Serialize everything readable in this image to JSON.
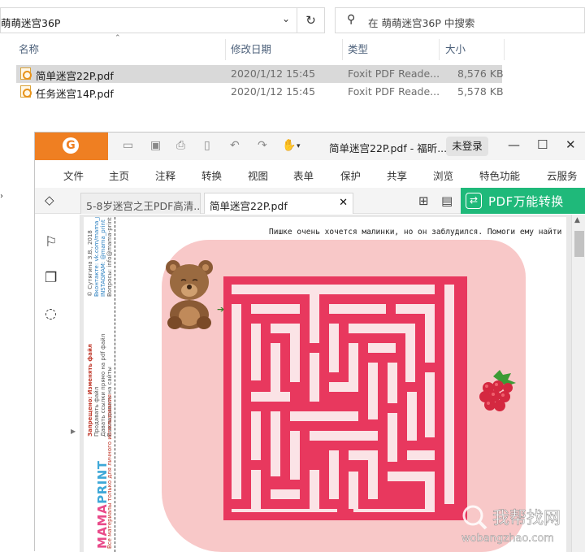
{
  "explorer": {
    "address_path": "萌萌迷宫36P",
    "search_placeholder": "在 萌萌迷宫36P 中搜索",
    "columns": {
      "name": "名称",
      "modified": "修改日期",
      "type": "类型",
      "size": "大小"
    },
    "files": [
      {
        "name": "简单迷宫22P.pdf",
        "modified": "2020/1/12 15:45",
        "type": "Foxit PDF Reade...",
        "size": "8,576 KB",
        "selected": true
      },
      {
        "name": "任务迷宫14P.pdf",
        "modified": "2020/1/12 15:45",
        "type": "Foxit PDF Reade...",
        "size": "5,578 KB",
        "selected": false
      }
    ]
  },
  "foxit": {
    "window_title": "简单迷宫22P.pdf - 福昕...",
    "login_label": "未登录",
    "accent_color": "#ef7f22",
    "menu": [
      "文件",
      "主页",
      "注释",
      "转换",
      "视图",
      "表单",
      "保护",
      "共享",
      "浏览",
      "特色功能",
      "云服务"
    ],
    "tabs": [
      {
        "label": "5-8岁迷宫之王PDF高清...",
        "active": false
      },
      {
        "label": "简单迷宫22P.pdf",
        "active": true
      }
    ],
    "convert_label": "PDF万能转换",
    "convert_color": "#1fb97a",
    "document": {
      "caption": "Пишке очень хочется малинки, но он заблудился. Помоги ему найти путь.",
      "brand_part1": "MAMA",
      "brand_part2": "PRINT",
      "sidebar_line1": "© Сутягина З.В., 2018",
      "sidebar_line2": "Вконтакте: vk.com/mama_print",
      "sidebar_line3": "INSTAGRAM: @mama_print",
      "sidebar_line4": "Вопросы: info@mama-print.ru",
      "sidebar_line5": "Запрещено: Изменять файл",
      "sidebar_line6": "Продавать файл",
      "sidebar_line7": "Давать ссылки прямо на pdf файл",
      "sidebar_line8": "Выкладывать на сайты",
      "sidebar_line9": "Все материалы только для личного использования",
      "maze_color": "#e8385e"
    }
  },
  "watermark": {
    "text1": "我帮找网",
    "text2": "wobangzhao.com"
  }
}
